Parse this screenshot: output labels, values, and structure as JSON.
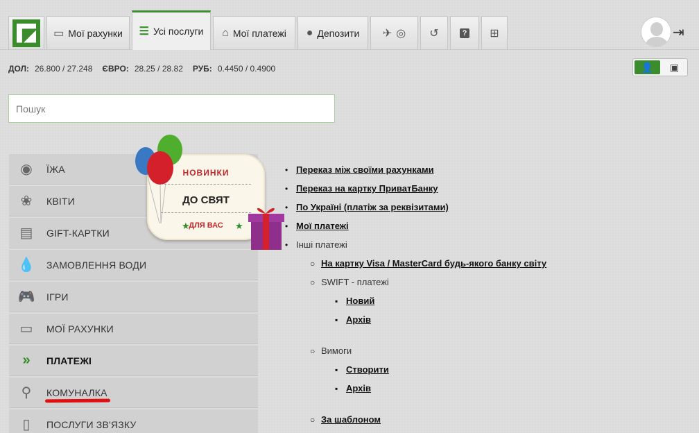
{
  "tabs": [
    {
      "label": "Мої рахунки",
      "icon": "card-icon"
    },
    {
      "label": "Усі послуги",
      "icon": "list-icon",
      "active": true
    },
    {
      "label": "Мої платежі",
      "icon": "house-icon"
    },
    {
      "label": "Депозити",
      "icon": "piggy-icon"
    }
  ],
  "rates": {
    "usd_label": "ДОЛ:",
    "usd_value": "26.800 / 27.248",
    "eur_label": "ЄВРО:",
    "eur_value": "28.25 / 28.82",
    "rub_label": "РУБ:",
    "rub_value": "0.4450 / 0.4900"
  },
  "search": {
    "placeholder": "Пошук"
  },
  "sidebar": {
    "items": [
      {
        "label": "ЇЖА",
        "icon": "food-icon"
      },
      {
        "label": "КВІТИ",
        "icon": "flower-icon"
      },
      {
        "label": "GIFT-КАРТКИ",
        "icon": "gift-card-icon"
      },
      {
        "label": "ЗАМОВЛЕННЯ ВОДИ",
        "icon": "water-drop-icon"
      },
      {
        "label": "ІГРИ",
        "icon": "gamepad-icon"
      },
      {
        "label": "МОЇ РАХУНКИ",
        "icon": "card-icon"
      },
      {
        "label": "ПЛАТЕЖІ",
        "icon": "double-chevron-icon",
        "active": true
      },
      {
        "label": "КОМУНАЛКА",
        "icon": "faucet-icon"
      },
      {
        "label": "ПОСЛУГИ ЗВ'ЯЗКУ",
        "icon": "phone-icon"
      }
    ]
  },
  "promo": {
    "line1": "НОВИНКИ",
    "line2": "ДО СВЯТ",
    "line3": "ДЛЯ ВАС"
  },
  "links": {
    "own_accounts": "Переказ між своїми рахунками",
    "privat_card": "Переказ на картку ПриватБанку",
    "ukraine": "По Україні (платіж за реквізитами)",
    "my_payments": "Мої платежі",
    "other": "Інші платежі",
    "visa_mc": "На картку Visa / MasterCard будь-якого банку світу",
    "swift": "SWIFT - платежі",
    "swift_new": "Новий",
    "swift_archive": "Архів",
    "claims": "Вимоги",
    "claims_create": "Створити",
    "claims_archive": "Архів",
    "template": "За шаблоном"
  },
  "colors": {
    "accent": "#3a8c2d",
    "underline": "#e01010"
  }
}
